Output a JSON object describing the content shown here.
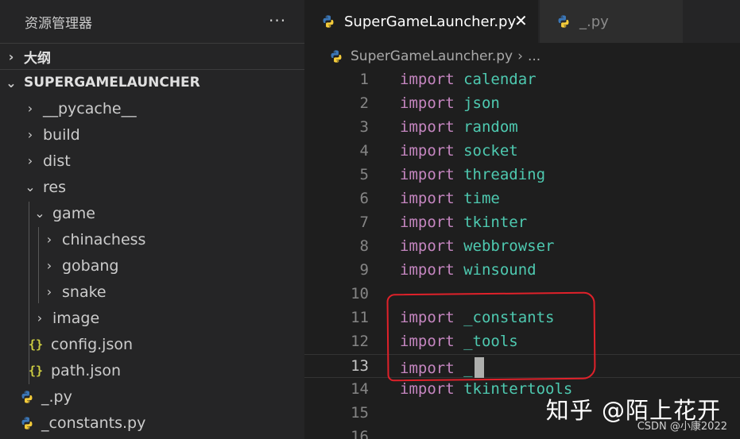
{
  "sidebar": {
    "title": "资源管理器",
    "more": "···",
    "outline": "大纲",
    "project": "SUPERGAMELAUNCHER",
    "tree": [
      {
        "label": "__pycache__",
        "type": "folder",
        "depth": 1,
        "expanded": false
      },
      {
        "label": "build",
        "type": "folder",
        "depth": 1,
        "expanded": false
      },
      {
        "label": "dist",
        "type": "folder",
        "depth": 1,
        "expanded": false
      },
      {
        "label": "res",
        "type": "folder",
        "depth": 1,
        "expanded": true
      },
      {
        "label": "game",
        "type": "folder",
        "depth": 2,
        "expanded": true
      },
      {
        "label": "chinachess",
        "type": "folder",
        "depth": 3,
        "expanded": false
      },
      {
        "label": "gobang",
        "type": "folder",
        "depth": 3,
        "expanded": false
      },
      {
        "label": "snake",
        "type": "folder",
        "depth": 3,
        "expanded": false
      },
      {
        "label": "image",
        "type": "folder",
        "depth": 2,
        "expanded": false
      },
      {
        "label": "config.json",
        "type": "json",
        "depth": 2
      },
      {
        "label": "path.json",
        "type": "json",
        "depth": 2
      },
      {
        "label": "_.py",
        "type": "py",
        "depth": 1
      },
      {
        "label": "_constants.py",
        "type": "py",
        "depth": 1
      }
    ]
  },
  "editor": {
    "tabs": [
      {
        "label": "SuperGameLauncher.py",
        "active": true,
        "close": "✕"
      },
      {
        "label": "_.py",
        "active": false
      }
    ],
    "breadcrumb": {
      "file": "SuperGameLauncher.py",
      "sep": "›",
      "more": "..."
    },
    "lines": [
      {
        "n": "1",
        "kw": "import",
        "mod": "calendar"
      },
      {
        "n": "2",
        "kw": "import",
        "mod": "json"
      },
      {
        "n": "3",
        "kw": "import",
        "mod": "random"
      },
      {
        "n": "4",
        "kw": "import",
        "mod": "socket"
      },
      {
        "n": "5",
        "kw": "import",
        "mod": "threading"
      },
      {
        "n": "6",
        "kw": "import",
        "mod": "time"
      },
      {
        "n": "7",
        "kw": "import",
        "mod": "tkinter"
      },
      {
        "n": "8",
        "kw": "import",
        "mod": "webbrowser"
      },
      {
        "n": "9",
        "kw": "import",
        "mod": "winsound"
      },
      {
        "n": "10",
        "kw": "",
        "mod": ""
      },
      {
        "n": "11",
        "kw": "import",
        "mod": "_constants"
      },
      {
        "n": "12",
        "kw": "import",
        "mod": "_tools"
      },
      {
        "n": "13",
        "kw": "import",
        "mod": "_",
        "current": true
      },
      {
        "n": "14",
        "kw": "import",
        "mod": "tkintertools"
      },
      {
        "n": "15",
        "kw": "",
        "mod": ""
      },
      {
        "n": "16",
        "kw": "",
        "mod": ""
      }
    ]
  },
  "watermark": {
    "main": "知乎 @陌上花开",
    "sub": "CSDN @小康2022"
  },
  "colors": {
    "keyword": "#c586c0",
    "module": "#4ec9b0",
    "annotation": "#e0212a",
    "json_icon": "#cbcb41"
  }
}
